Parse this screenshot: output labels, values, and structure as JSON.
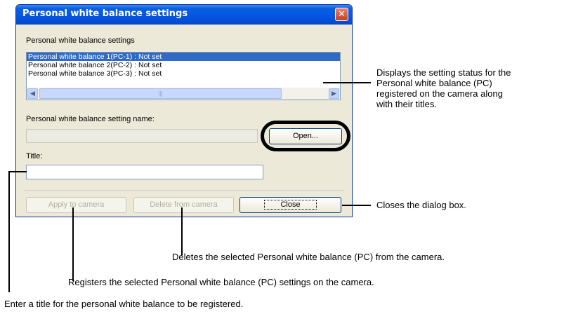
{
  "dialog": {
    "title": "Personal white balance settings",
    "close_glyph": "✕",
    "group_label": "Personal white balance settings",
    "list_items": [
      "Personal white balance 1(PC-1) : Not set",
      "Personal white balance 2(PC-2) : Not set",
      "Personal white balance 3(PC-3) : Not set"
    ],
    "selected_index": 0,
    "setting_name_label": "Personal white balance setting name:",
    "setting_name_value": "",
    "open_button": "Open...",
    "title_label": "Title:",
    "title_value": "",
    "apply_button": "Apply to camera",
    "delete_button": "Delete from camera",
    "close_button": "Close"
  },
  "callouts": {
    "list": "Displays the setting status for the\nPersonal white balance (PC)\nregistered on the camera along\nwith their titles.",
    "close": "Closes the dialog box.",
    "delete": "Deletes the selected Personal white balance (PC) from the camera.",
    "apply": "Registers the selected Personal white balance (PC) settings on the camera.",
    "title": "Enter a title for the personal white balance to be registered."
  },
  "colors": {
    "titlebar": "#0554e3",
    "selection": "#316ac5",
    "dialog_bg": "#ece9d8"
  },
  "icons": [
    "close-icon",
    "scroll-left-icon",
    "scroll-right-icon",
    "scroll-grip-icon"
  ]
}
